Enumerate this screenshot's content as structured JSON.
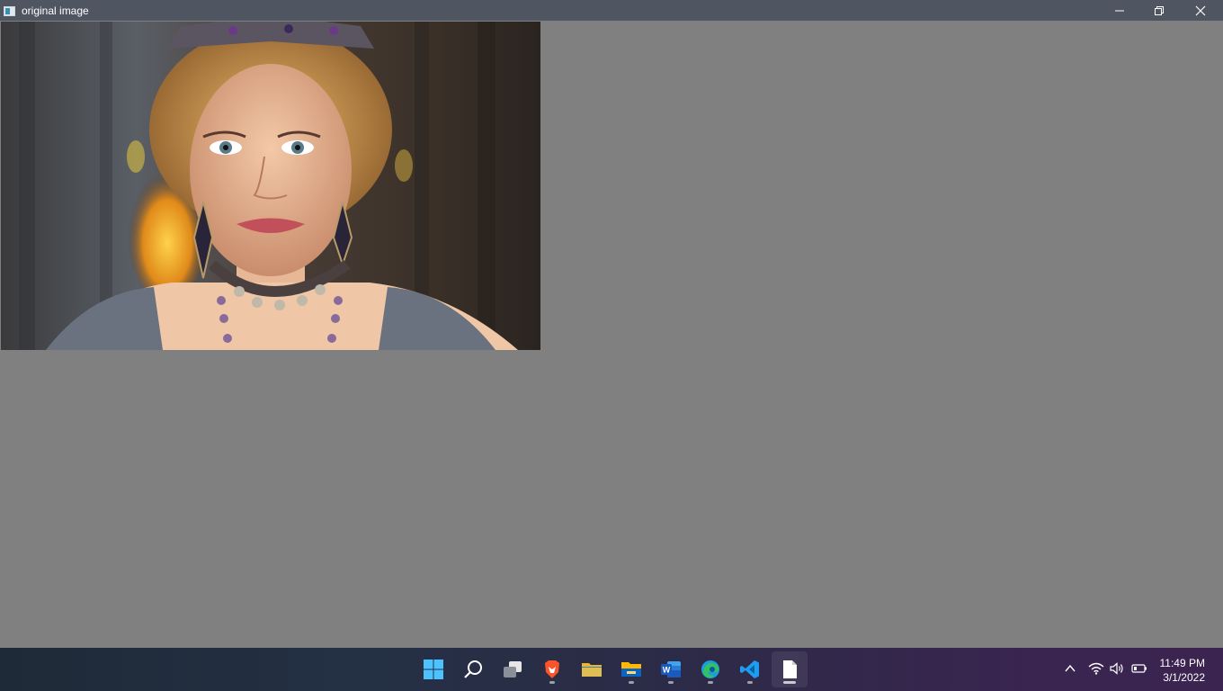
{
  "window": {
    "title": "original image",
    "icons": {
      "app": "image-window-icon",
      "minimize": "minimize-icon",
      "maximize": "restore-icon",
      "close": "close-icon"
    }
  },
  "viewer": {
    "background": "#808080",
    "image": {
      "description_name": "portrait-photo"
    }
  },
  "taskbar": {
    "items": [
      {
        "name": "start",
        "icon": "windows-start-icon",
        "running": false
      },
      {
        "name": "search",
        "icon": "search-icon",
        "running": false
      },
      {
        "name": "task-view",
        "icon": "task-view-icon",
        "running": false
      },
      {
        "name": "brave",
        "icon": "brave-browser-icon",
        "running": true
      },
      {
        "name": "file-explorer-folder",
        "icon": "folder-icon",
        "running": false
      },
      {
        "name": "file-explorer",
        "icon": "file-explorer-icon",
        "running": true
      },
      {
        "name": "word",
        "icon": "word-icon",
        "running": true
      },
      {
        "name": "edge",
        "icon": "edge-icon",
        "running": true
      },
      {
        "name": "vscode",
        "icon": "vscode-icon",
        "running": true
      },
      {
        "name": "image-window",
        "icon": "document-icon",
        "running": true,
        "active": true
      }
    ],
    "tray": {
      "icons": [
        "chevron-up-icon",
        "wifi-icon",
        "volume-icon",
        "battery-icon"
      ]
    },
    "clock": {
      "time": "11:49 PM",
      "date": "3/1/2022"
    }
  }
}
